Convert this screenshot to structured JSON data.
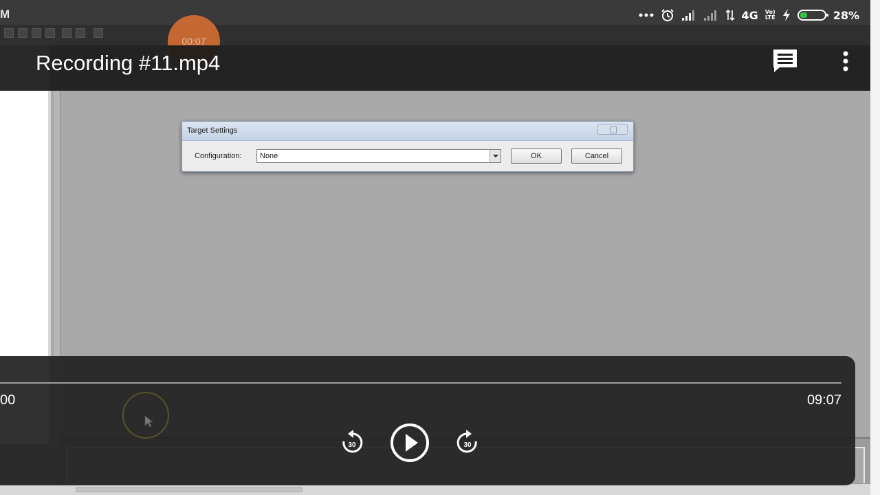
{
  "status_bar": {
    "app_letter": "M",
    "network_type": "4G",
    "volte_top": "Vo)",
    "volte_bottom": "LTE",
    "battery_percent": "28%",
    "battery_level": 0.28,
    "colors": {
      "icon": "#ffffff",
      "battery_fill": "#34c34a"
    }
  },
  "app_bar": {
    "title": "Recording #11.mp4",
    "icons": [
      "subtitles-icon",
      "more-vert-icon"
    ]
  },
  "recording_indicator": {
    "elapsed": "00:07",
    "color": "#d66e32"
  },
  "video_frame": {
    "background_color": "#a9a9a9",
    "dialog": {
      "title": "Target Settings",
      "configuration_label": "Configuration:",
      "configuration_value": "None",
      "ok_label": "OK",
      "cancel_label": "Cancel"
    }
  },
  "player": {
    "current_time": "00",
    "total_time": "09:07",
    "progress_fraction": 0.0,
    "rewind_seconds": "30",
    "forward_seconds": "30",
    "controls": [
      "replay-30-icon",
      "play-icon",
      "forward-30-icon"
    ],
    "colors": {
      "panel": "#212121",
      "track": "#9e9e9e",
      "text": "#ffffff"
    }
  }
}
